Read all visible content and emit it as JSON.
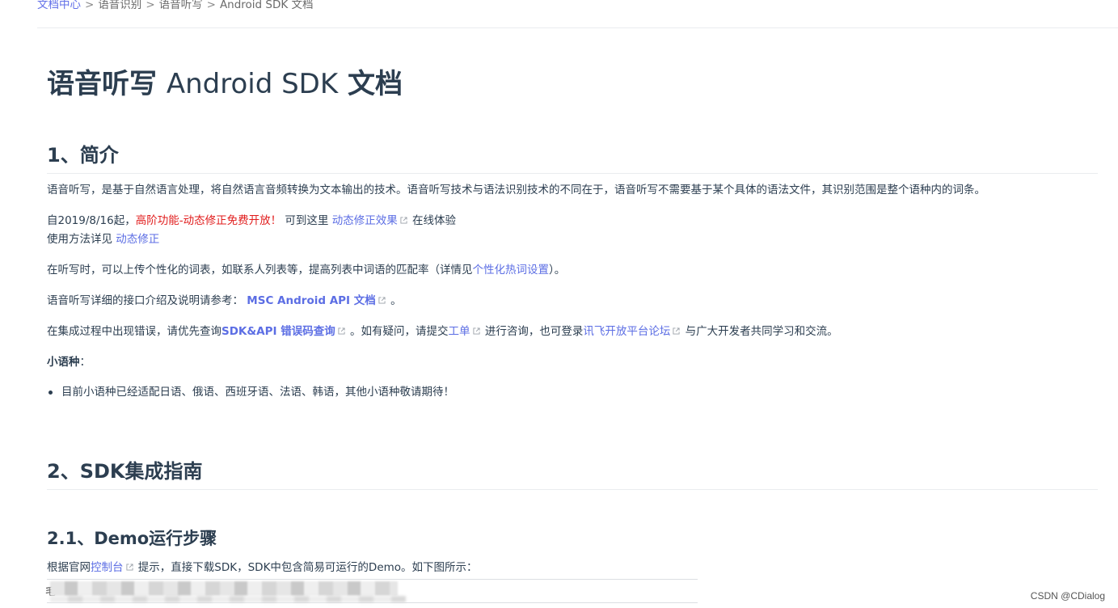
{
  "breadcrumb": {
    "items": [
      "文档中心",
      "语音识别",
      "语音听写",
      "Android SDK 文档"
    ],
    "separator": ">"
  },
  "page_title": {
    "zh1": "语音听写",
    "latin": "Android SDK",
    "zh2": "文档"
  },
  "section1": {
    "heading": "1、简介",
    "intro": "语音听写，是基于自然语言处理，将自然语言音频转换为文本输出的技术。语音听写技术与语法识别技术的不同在于，语音听写不需要基于某个具体的语法文件，其识别范围是整个语种内的词条。",
    "since_prefix": "自2019/8/16起，",
    "since_highlight": "高阶功能-动态修正免费开放！",
    "since_mid": "可到这里",
    "dynamic_link": "动态修正效果",
    "since_suffix": "在线体验",
    "usage_prefix": "使用方法详见",
    "usage_link": "动态修正",
    "hotword_prefix": "在听写时，可以上传个性化的词表，如联系人列表等，提高列表中词语的匹配率（详情见",
    "hotword_link": "个性化热词设置",
    "hotword_suffix": "）。",
    "api_prefix": "语音听写详细的接口介绍及说明请参考：",
    "api_link": "MSC Android API 文档",
    "api_suffix": "。",
    "err_prefix": "在集成过程中出现错误，请优先查询",
    "err_link": "SDK&API 错误码查询",
    "err_mid": "。如有疑问，请提交",
    "ticket_link": "工单",
    "err_mid2": "进行咨询，也可登录",
    "forum_link": "讯飞开放平台论坛",
    "err_suffix": "与广大开发者共同学习和交流。",
    "minor_label": "小语种",
    "minor_colon": "：",
    "minor_items": [
      "目前小语种已经适配日语、俄语、西班牙语、法语、韩语，其他小语种敬请期待！"
    ]
  },
  "section2": {
    "heading": "2、SDK集成指南",
    "sub1": {
      "heading": "2.1、Demo运行步骤",
      "text_prefix": "根据官网",
      "console_link": "控制台",
      "text_suffix": "提示，直接下载SDK，SDK中包含简易可运行的Demo。如下图所示："
    }
  },
  "blurred_glyph": "毛",
  "watermark": "CSDN @CDialog",
  "colors": {
    "link": "#5c6ee4",
    "highlight_red": "#e11d1d",
    "text": "#2c3e50"
  }
}
